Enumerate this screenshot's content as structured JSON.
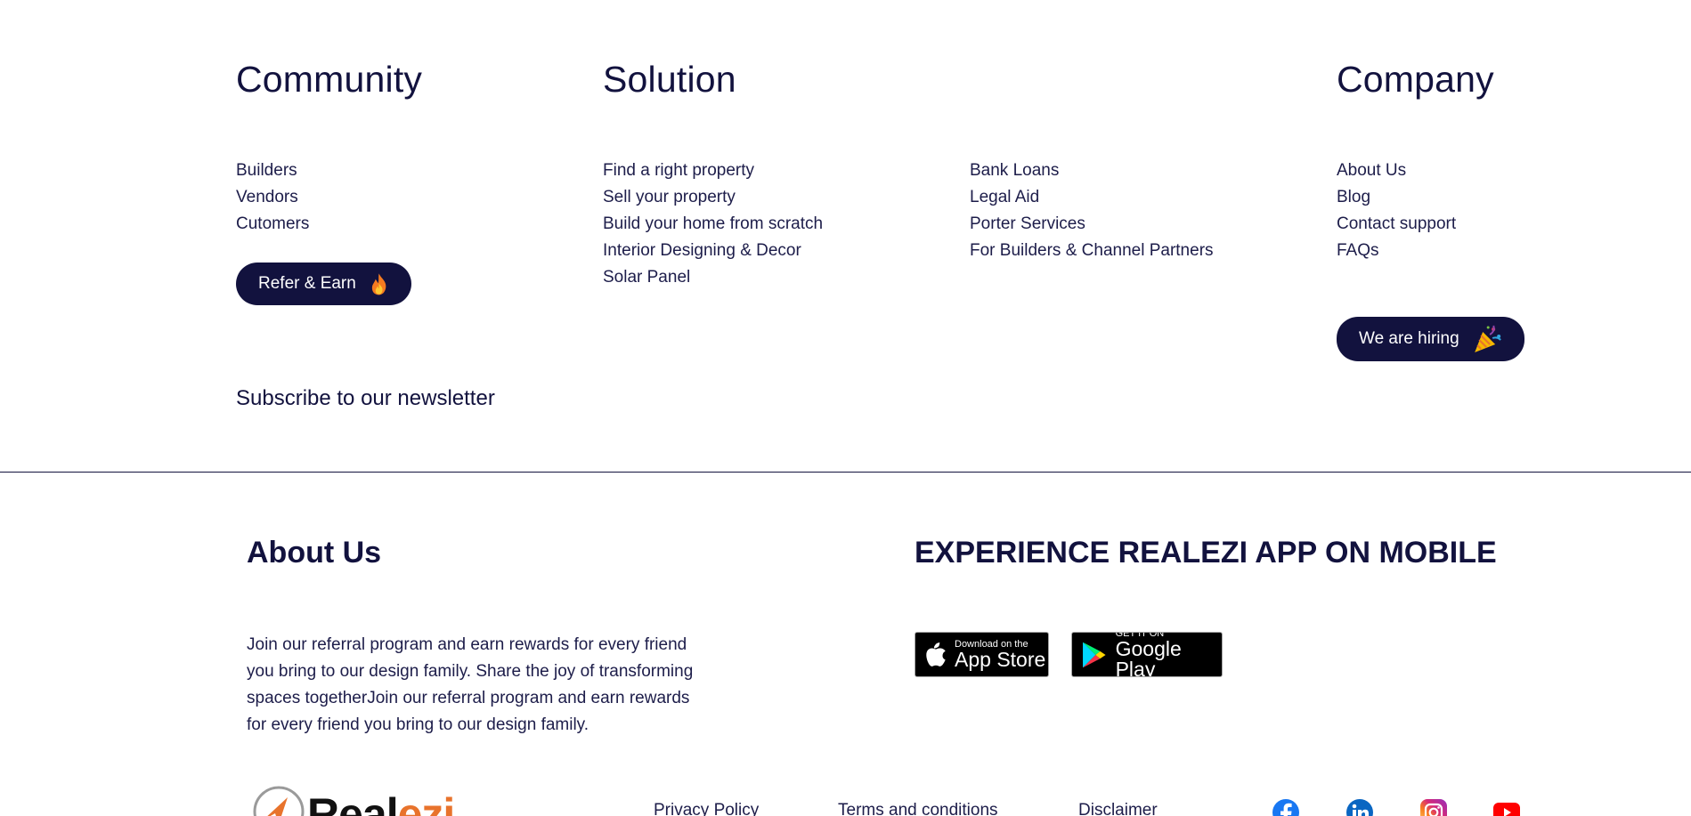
{
  "community": {
    "heading": "Community",
    "links": [
      "Builders",
      "Vendors",
      "Cutomers"
    ],
    "refer_button": "Refer & Earn",
    "refer_icon": "fire-icon"
  },
  "solution": {
    "heading": "Solution",
    "links_a": [
      "Find a right property",
      "Sell your property",
      "Build your home from scratch",
      "Interior Designing & Decor",
      "Solar Panel"
    ],
    "links_b": [
      "Bank Loans",
      "Legal Aid",
      "Porter Services",
      "For Builders & Channel Partners"
    ]
  },
  "company": {
    "heading": "Company",
    "links": [
      "About Us",
      "Blog",
      "Contact support",
      "FAQs"
    ],
    "hiring_button": "We are hiring",
    "hiring_icon": "party-popper-icon"
  },
  "newsletter": {
    "label": "Subscribe to our newsletter"
  },
  "about": {
    "title": "About Us",
    "text": "Join our referral program and earn rewards for every friend you bring to our design family. Share the joy of transforming spaces togetherJoin our referral program and earn rewards for every friend you bring to our design family."
  },
  "app": {
    "title": "EXPERIENCE REALEZI APP ON MOBILE",
    "app_store": {
      "small": "Download on the",
      "big": "App Store"
    },
    "google_play": {
      "small": "GET IT ON",
      "big": "Google Play"
    }
  },
  "footer": {
    "brand_a": "Real",
    "brand_b": "ezi",
    "links": [
      "Privacy Policy",
      "Terms and conditions",
      "Disclaimer"
    ],
    "social": [
      "facebook-icon",
      "linkedin-icon",
      "instagram-icon",
      "youtube-icon"
    ]
  },
  "colors": {
    "navy": "#12123e",
    "brand_orange": "#e8732c"
  }
}
